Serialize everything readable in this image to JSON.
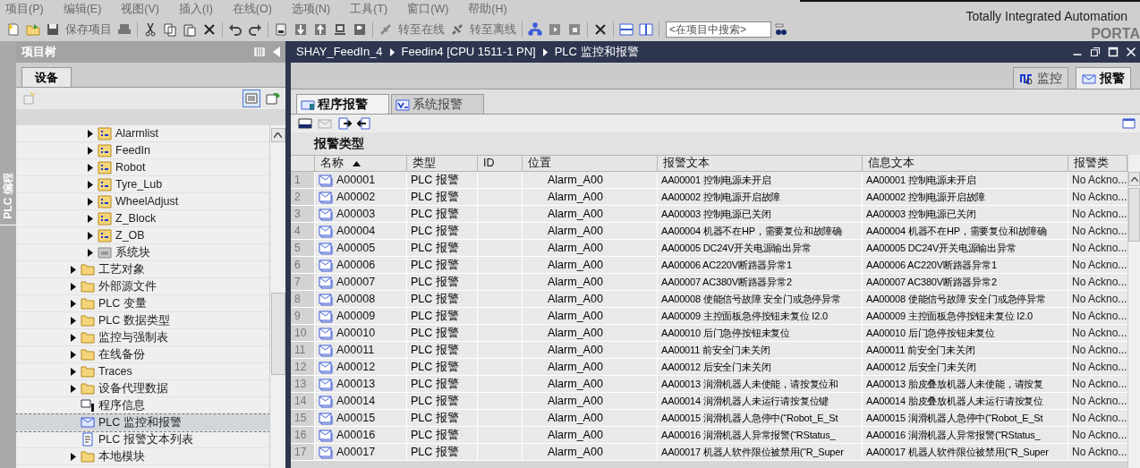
{
  "menu": [
    "项目(P)",
    "编辑(E)",
    "视图(V)",
    "插入(I)",
    "在线(O)",
    "选项(N)",
    "工具(T)",
    "窗口(W)",
    "帮助(H)"
  ],
  "toolbar": {
    "save": "保存项目",
    "go_online": "转至在线",
    "go_offline": "转至离线",
    "search_placeholder": "<在项目中搜索>"
  },
  "brand": {
    "title": "Totally Integrated Automation",
    "subtitle": "PORTA"
  },
  "side_strip": {
    "label": "PLC 编程"
  },
  "project_tree": {
    "title": "项目树",
    "tabs": [
      {
        "label": "设备",
        "selected": true
      }
    ],
    "items": [
      {
        "children": [
          {
            "label": "Alarmlist",
            "kind": "block-group",
            "selected": false
          },
          {
            "label": "FeedIn",
            "kind": "block-group",
            "selected": false
          },
          {
            "label": "Robot",
            "kind": "block-group",
            "selected": false
          },
          {
            "label": "Tyre_Lub",
            "kind": "block-group",
            "selected": false
          },
          {
            "label": "WheelAdjust",
            "kind": "block-group",
            "selected": false
          },
          {
            "label": "Z_Block",
            "kind": "block-group",
            "selected": false
          },
          {
            "label": "Z_OB",
            "kind": "block-group",
            "selected": false
          },
          {
            "label": "系统块",
            "kind": "system-group",
            "selected": false
          }
        ]
      },
      {
        "label": "工艺对象",
        "kind": "folder",
        "selected": false
      },
      {
        "label": "外部源文件",
        "kind": "folder",
        "selected": false
      },
      {
        "label": "PLC 变量",
        "kind": "folder",
        "selected": false
      },
      {
        "label": "PLC 数据类型",
        "kind": "folder",
        "selected": false
      },
      {
        "label": "监控与强制表",
        "kind": "folder",
        "selected": false
      },
      {
        "label": "在线备份",
        "kind": "folder",
        "selected": false
      },
      {
        "label": "Traces",
        "kind": "folder",
        "selected": false
      },
      {
        "label": "设备代理数据",
        "kind": "folder",
        "selected": false
      },
      {
        "label": "程序信息",
        "kind": "program-info",
        "selected": false
      },
      {
        "label": "PLC 监控和报警",
        "kind": "alarm-view",
        "selected": true
      },
      {
        "label": "PLC 报警文本列表",
        "kind": "text-list",
        "selected": false
      },
      {
        "label": "本地模块",
        "kind": "folder",
        "selected": false
      }
    ]
  },
  "editor": {
    "breadcrumb": [
      "SHAY_FeedIn_4",
      "Feedin4 [CPU 1511-1 PN]",
      "PLC 监控和报警"
    ],
    "view_tabs": [
      {
        "label": "监控",
        "kind": "monitor",
        "selected": false
      },
      {
        "label": "报警",
        "kind": "alarm",
        "selected": true
      }
    ],
    "alarm_tabs": [
      {
        "label": "程序报警",
        "kind": "program",
        "selected": true
      },
      {
        "label": "系统报警",
        "kind": "system",
        "selected": false
      }
    ],
    "section_title": "报警类型",
    "table": {
      "columns": [
        {
          "label": "名称",
          "sorted": true
        },
        {
          "label": "类型",
          "sorted": false
        },
        {
          "label": "ID",
          "sorted": false
        },
        {
          "label": "位置",
          "sorted": false
        },
        {
          "label": "报警文本",
          "sorted": false
        },
        {
          "label": "信息文本",
          "sorted": false
        },
        {
          "label": "报警类",
          "sorted": false
        }
      ],
      "rows": [
        {
          "number": "1",
          "name": "A00001",
          "type": "PLC 报警",
          "location": "Alarm_A00",
          "alarm_text": "AA00001 控制电源未开启",
          "info_text": "AA00001 控制电源未开启",
          "class": "No Ackno..."
        },
        {
          "number": "2",
          "name": "A00002",
          "type": "PLC 报警",
          "location": "Alarm_A00",
          "alarm_text": "AA00002 控制电源开启故障",
          "info_text": "AA00002 控制电源开启故障",
          "class": "No Ackno..."
        },
        {
          "number": "3",
          "name": "A00003",
          "type": "PLC 报警",
          "location": "Alarm_A00",
          "alarm_text": "AA00003 控制电源已关闭",
          "info_text": "AA00003 控制电源已关闭",
          "class": "No Ackno..."
        },
        {
          "number": "4",
          "name": "A00004",
          "type": "PLC 报警",
          "location": "Alarm_A00",
          "alarm_text": "AA00004 机器不在HP，需要复位和故障确",
          "info_text": "AA00004 机器不在HP，需要复位和故障确",
          "class": "No Ackno..."
        },
        {
          "number": "5",
          "name": "A00005",
          "type": "PLC 报警",
          "location": "Alarm_A00",
          "alarm_text": "AA00005 DC24V开关电源输出异常",
          "info_text": "AA00005 DC24V开关电源输出异常",
          "class": "No Ackno..."
        },
        {
          "number": "6",
          "name": "A00006",
          "type": "PLC 报警",
          "location": "Alarm_A00",
          "alarm_text": "AA00006 AC220V断路器异常1",
          "info_text": "AA00006 AC220V断路器异常1",
          "class": "No Ackno..."
        },
        {
          "number": "7",
          "name": "A00007",
          "type": "PLC 报警",
          "location": "Alarm_A00",
          "alarm_text": "AA00007 AC380V断路器异常2",
          "info_text": "AA00007 AC380V断路器异常2",
          "class": "No Ackno..."
        },
        {
          "number": "8",
          "name": "A00008",
          "type": "PLC 报警",
          "location": "Alarm_A00",
          "alarm_text": "AA00008 使能信号故障 安全门或急停异常",
          "info_text": "AA00008 使能信号故障 安全门或急停异常",
          "class": "No Ackno..."
        },
        {
          "number": "9",
          "name": "A00009",
          "type": "PLC 报警",
          "location": "Alarm_A00",
          "alarm_text": "AA00009 主控面板急停按钮未复位 I2.0",
          "info_text": "AA00009 主控面板急停按钮未复位 I2.0",
          "class": "No Ackno..."
        },
        {
          "number": "10",
          "name": "A00010",
          "type": "PLC 报警",
          "location": "Alarm_A00",
          "alarm_text": "AA00010 后门急停按钮未复位",
          "info_text": "AA00010 后门急停按钮未复位",
          "class": "No Ackno..."
        },
        {
          "number": "11",
          "name": "A00011",
          "type": "PLC 报警",
          "location": "Alarm_A00",
          "alarm_text": "AA00011 前安全门未关闭",
          "info_text": "AA00011 前安全门未关闭",
          "class": "No Ackno..."
        },
        {
          "number": "12",
          "name": "A00012",
          "type": "PLC 报警",
          "location": "Alarm_A00",
          "alarm_text": "AA00012 后安全门未关闭",
          "info_text": "AA00012 后安全门未关闭",
          "class": "No Ackno..."
        },
        {
          "number": "13",
          "name": "A00013",
          "type": "PLC 报警",
          "location": "Alarm_A00",
          "alarm_text": "AA00013 润滑机器人未使能，请按复位和",
          "info_text": "AA00013 胎皮叠放机器人未使能，请按复",
          "class": "No Ackno..."
        },
        {
          "number": "14",
          "name": "A00014",
          "type": "PLC 报警",
          "location": "Alarm_A00",
          "alarm_text": "AA00014 润滑机器人未运行请按复位键",
          "info_text": "AA00014 胎皮叠放机器人未运行请按复位",
          "class": "No Ackno..."
        },
        {
          "number": "15",
          "name": "A00015",
          "type": "PLC 报警",
          "location": "Alarm_A00",
          "alarm_text": "AA00015 润滑机器人急停中(“Robot_E_St",
          "info_text": "AA00015 润滑机器人急停中(“Robot_E_St",
          "class": "No Ackno..."
        },
        {
          "number": "16",
          "name": "A00016",
          "type": "PLC 报警",
          "location": "Alarm_A00",
          "alarm_text": "AA00016 润滑机器人异常报警(“RStatus_",
          "info_text": "AA00016 润滑机器人异常报警(“RStatus_",
          "class": "No Ackno..."
        },
        {
          "number": "17",
          "name": "A00017",
          "type": "PLC 报警",
          "location": "Alarm_A00",
          "alarm_text": "AA00017 机器人软件限位被禁用(“R_Super",
          "info_text": "AA00017 机器人软件限位被禁用(“R_Super",
          "class": "No Ackno..."
        }
      ]
    }
  }
}
